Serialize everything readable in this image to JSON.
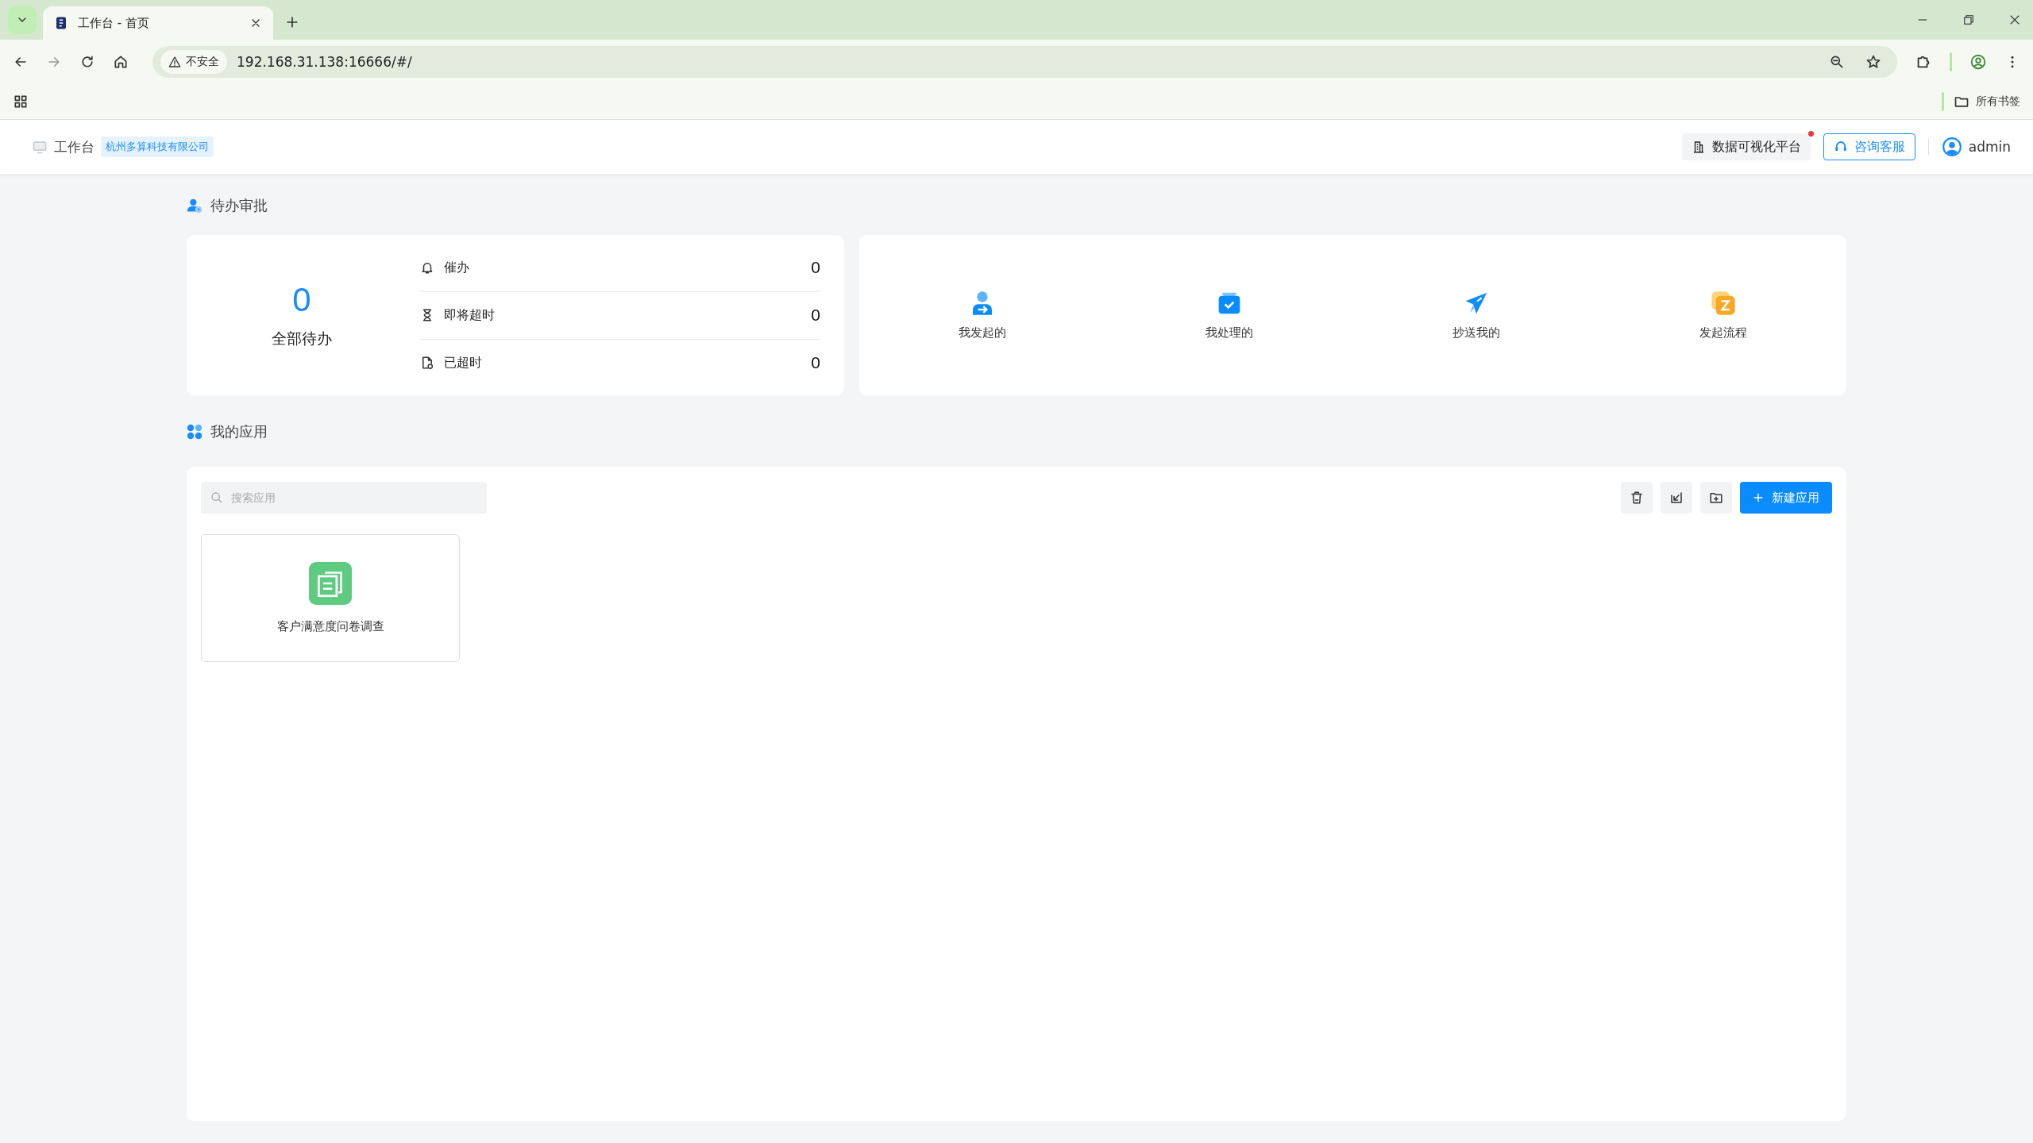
{
  "browser": {
    "tabs": [
      {
        "title": "工作台 - 首页",
        "selected": true
      }
    ],
    "address": {
      "security": "不安全",
      "url": "192.168.31.138:16666/#/"
    },
    "bookmark_folder": "所有书签"
  },
  "header": {
    "title": "工作台",
    "company": "杭州多算科技有限公司",
    "actions": [
      {
        "kind": "platform",
        "label": "数据可视化平台",
        "notify": true
      },
      {
        "kind": "service",
        "label": "咨询客服",
        "notify": false
      }
    ],
    "user": "admin"
  },
  "pending": {
    "title": "待办审批",
    "total": {
      "value": "0",
      "label": "全部待办"
    },
    "items": [
      {
        "kind": "urge",
        "label": "催办",
        "count": "0"
      },
      {
        "kind": "soon",
        "label": "即将超时",
        "count": "0"
      },
      {
        "kind": "overdue",
        "label": "已超时",
        "count": "0"
      }
    ]
  },
  "shortcuts": [
    {
      "kind": "started",
      "label": "我发起的"
    },
    {
      "kind": "handled",
      "label": "我处理的"
    },
    {
      "kind": "cc",
      "label": "抄送我的"
    },
    {
      "kind": "start",
      "label": "发起流程"
    }
  ],
  "apps": {
    "title": "我的应用",
    "search": {
      "placeholder": "搜索应用"
    },
    "tools": [
      {
        "kind": "delete"
      },
      {
        "kind": "import"
      },
      {
        "kind": "folder"
      }
    ],
    "new_button": "新建应用",
    "items": [
      {
        "name": "客户满意度问卷调查"
      }
    ]
  }
}
